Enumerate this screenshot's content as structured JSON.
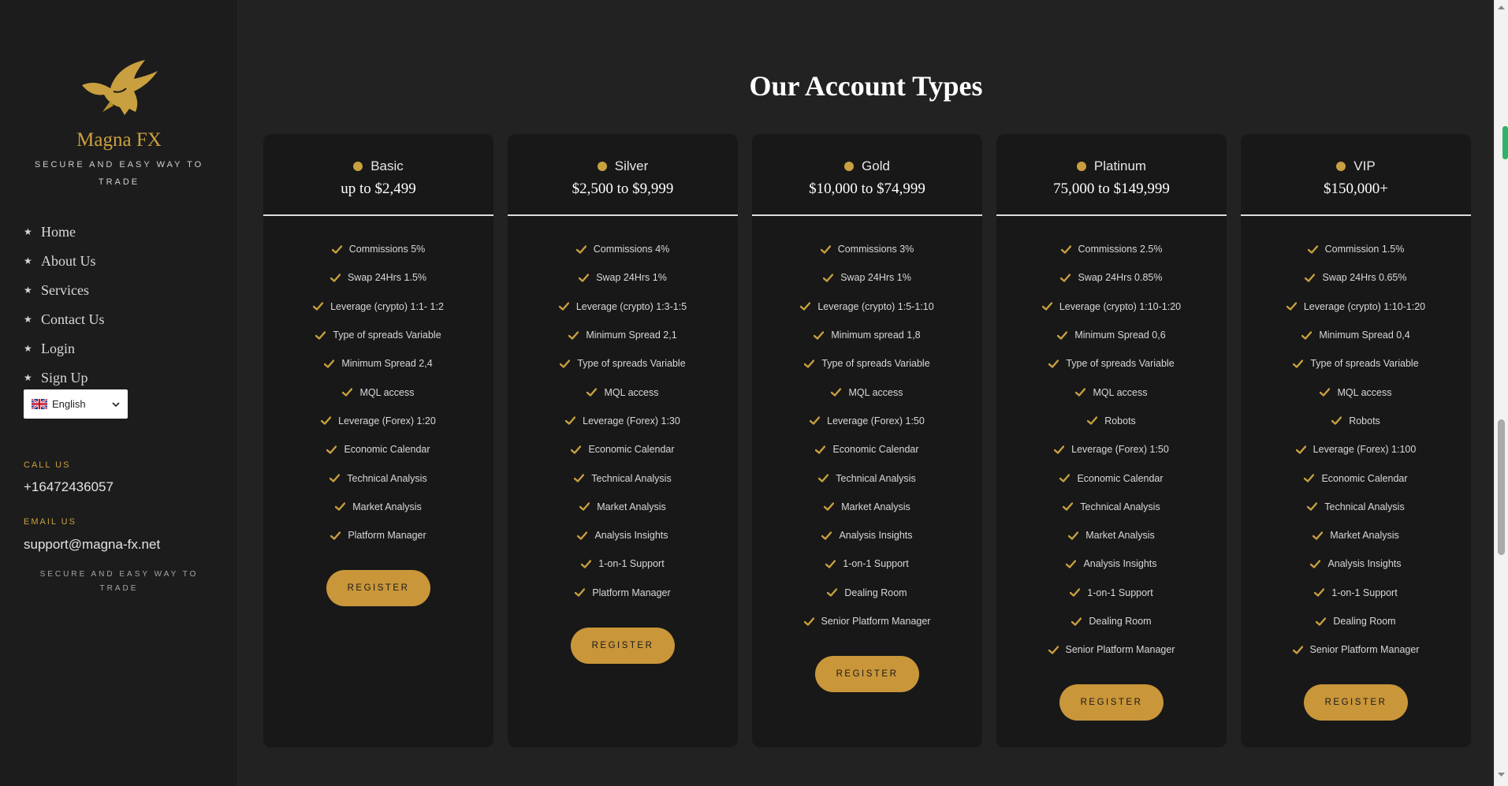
{
  "sidebar": {
    "brand": "Magna FX",
    "tagline": "SECURE AND EASY WAY TO TRADE",
    "nav": [
      "Home",
      "About Us",
      "Services",
      "Contact Us",
      "Login",
      "Sign Up"
    ],
    "language": "English",
    "call_label": "CALL US",
    "phone": "+16472436057",
    "email_label": "EMAIL US",
    "email": "support@magna-fx.net",
    "footer_tagline": "SECURE AND EASY WAY TO TRADE"
  },
  "main": {
    "title": "Our Account Types",
    "register_label": "REGISTER",
    "cards": [
      {
        "name": "Basic",
        "price": "up to $2,499",
        "features": [
          "Commissions 5%",
          "Swap 24Hrs 1.5%",
          "Leverage (crypto) 1:1- 1:2",
          "Type of spreads Variable",
          "Minimum Spread 2,4",
          "MQL access",
          "Leverage (Forex) 1:20",
          "Economic Calendar",
          "Technical Analysis",
          "Market Analysis",
          "Platform Manager"
        ]
      },
      {
        "name": "Silver",
        "price": "$2,500 to $9,999",
        "features": [
          "Commissions 4%",
          "Swap 24Hrs 1%",
          "Leverage (crypto) 1:3-1:5",
          "Minimum Spread 2,1",
          "Type of spreads Variable",
          "MQL access",
          "Leverage (Forex) 1:30",
          "Economic Calendar",
          "Technical Analysis",
          "Market Analysis",
          "Analysis Insights",
          "1-on-1 Support",
          "Platform Manager"
        ]
      },
      {
        "name": "Gold",
        "price": "$10,000 to $74,999",
        "features": [
          "Commissions 3%",
          "Swap 24Hrs 1%",
          "Leverage (crypto) 1:5-1:10",
          "Minimum spread 1,8",
          "Type of spreads Variable",
          "MQL access",
          "Leverage (Forex) 1:50",
          "Economic Calendar",
          "Technical Analysis",
          "Market Analysis",
          "Analysis Insights",
          "1-on-1 Support",
          "Dealing Room",
          "Senior Platform Manager"
        ]
      },
      {
        "name": "Platinum",
        "price": "75,000 to $149,999",
        "features": [
          "Commissions 2.5%",
          "Swap 24Hrs 0.85%",
          "Leverage (crypto) 1:10-1:20",
          "Minimum Spread 0,6",
          "Type of spreads Variable",
          "MQL access",
          "Robots",
          "Leverage (Forex) 1:50",
          "Economic Calendar",
          "Technical Analysis",
          "Market Analysis",
          "Analysis Insights",
          "1-on-1 Support",
          "Dealing Room",
          "Senior Platform Manager"
        ]
      },
      {
        "name": "VIP",
        "price": "$150,000+",
        "features": [
          "Commission 1.5%",
          "Swap 24Hrs 0.65%",
          "Leverage (crypto) 1:10-1:20",
          "Minimum Spread 0,4",
          "Type of spreads Variable",
          "MQL access",
          "Robots",
          "Leverage (Forex) 1:100",
          "Economic Calendar",
          "Technical Analysis",
          "Market Analysis",
          "Analysis Insights",
          "1-on-1 Support",
          "Dealing Room",
          "Senior Platform Manager"
        ]
      }
    ]
  },
  "colors": {
    "accent": "#c9a03f",
    "button": "#c9963a",
    "card_bg": "#181818",
    "page_bg": "#222222"
  }
}
